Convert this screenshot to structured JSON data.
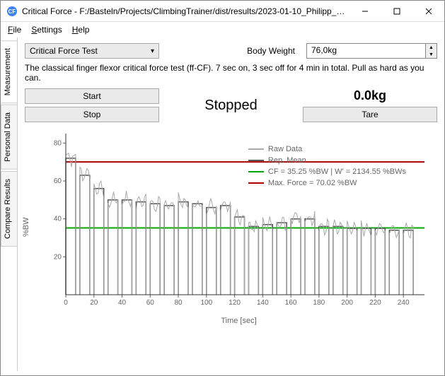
{
  "title": "Critical Force - F:/Basteln/Projects/ClimbingTrainer/dist/results/2023-01-10_Philipp_C...",
  "menus": {
    "file": "File",
    "settings": "Settings",
    "help": "Help"
  },
  "sidetabs": [
    "Measurement",
    "Personal Data",
    "Compare Results"
  ],
  "combo": "Critical Force Test",
  "bodyweight_label": "Body Weight",
  "bodyweight_value": "76,0kg",
  "description": "The classical finger flexor critical force test (ff-CF). 7 sec on, 3 sec off for 4 min in total. Pull as hard as you can.",
  "buttons": {
    "start": "Start",
    "stop": "Stop",
    "tare": "Tare"
  },
  "status": "Stopped",
  "current_force": "0.0kg",
  "chart_data": {
    "type": "line",
    "title": "",
    "xlabel": "Time [sec]",
    "ylabel": "%BW",
    "xlim": [
      0,
      255
    ],
    "ylim": [
      0,
      85
    ],
    "xticks": [
      0,
      20,
      40,
      60,
      80,
      100,
      120,
      140,
      160,
      180,
      200,
      220,
      240
    ],
    "yticks": [
      20,
      40,
      60,
      80
    ],
    "cf_line": 35.25,
    "maxforce_line": 70.02,
    "legend": {
      "raw": "Raw Data",
      "rep": "Rep. Mean",
      "cf": "CF = 35.25 %BW | W' = 2134.55 %BWs",
      "max": "Max. Force = 70.02 %BW"
    },
    "rep_means": [
      72,
      63,
      56,
      50,
      50,
      49,
      48,
      47,
      49,
      48,
      46,
      47,
      41,
      36,
      37,
      38,
      40,
      40,
      36,
      36,
      35,
      35,
      35,
      34,
      34
    ]
  }
}
